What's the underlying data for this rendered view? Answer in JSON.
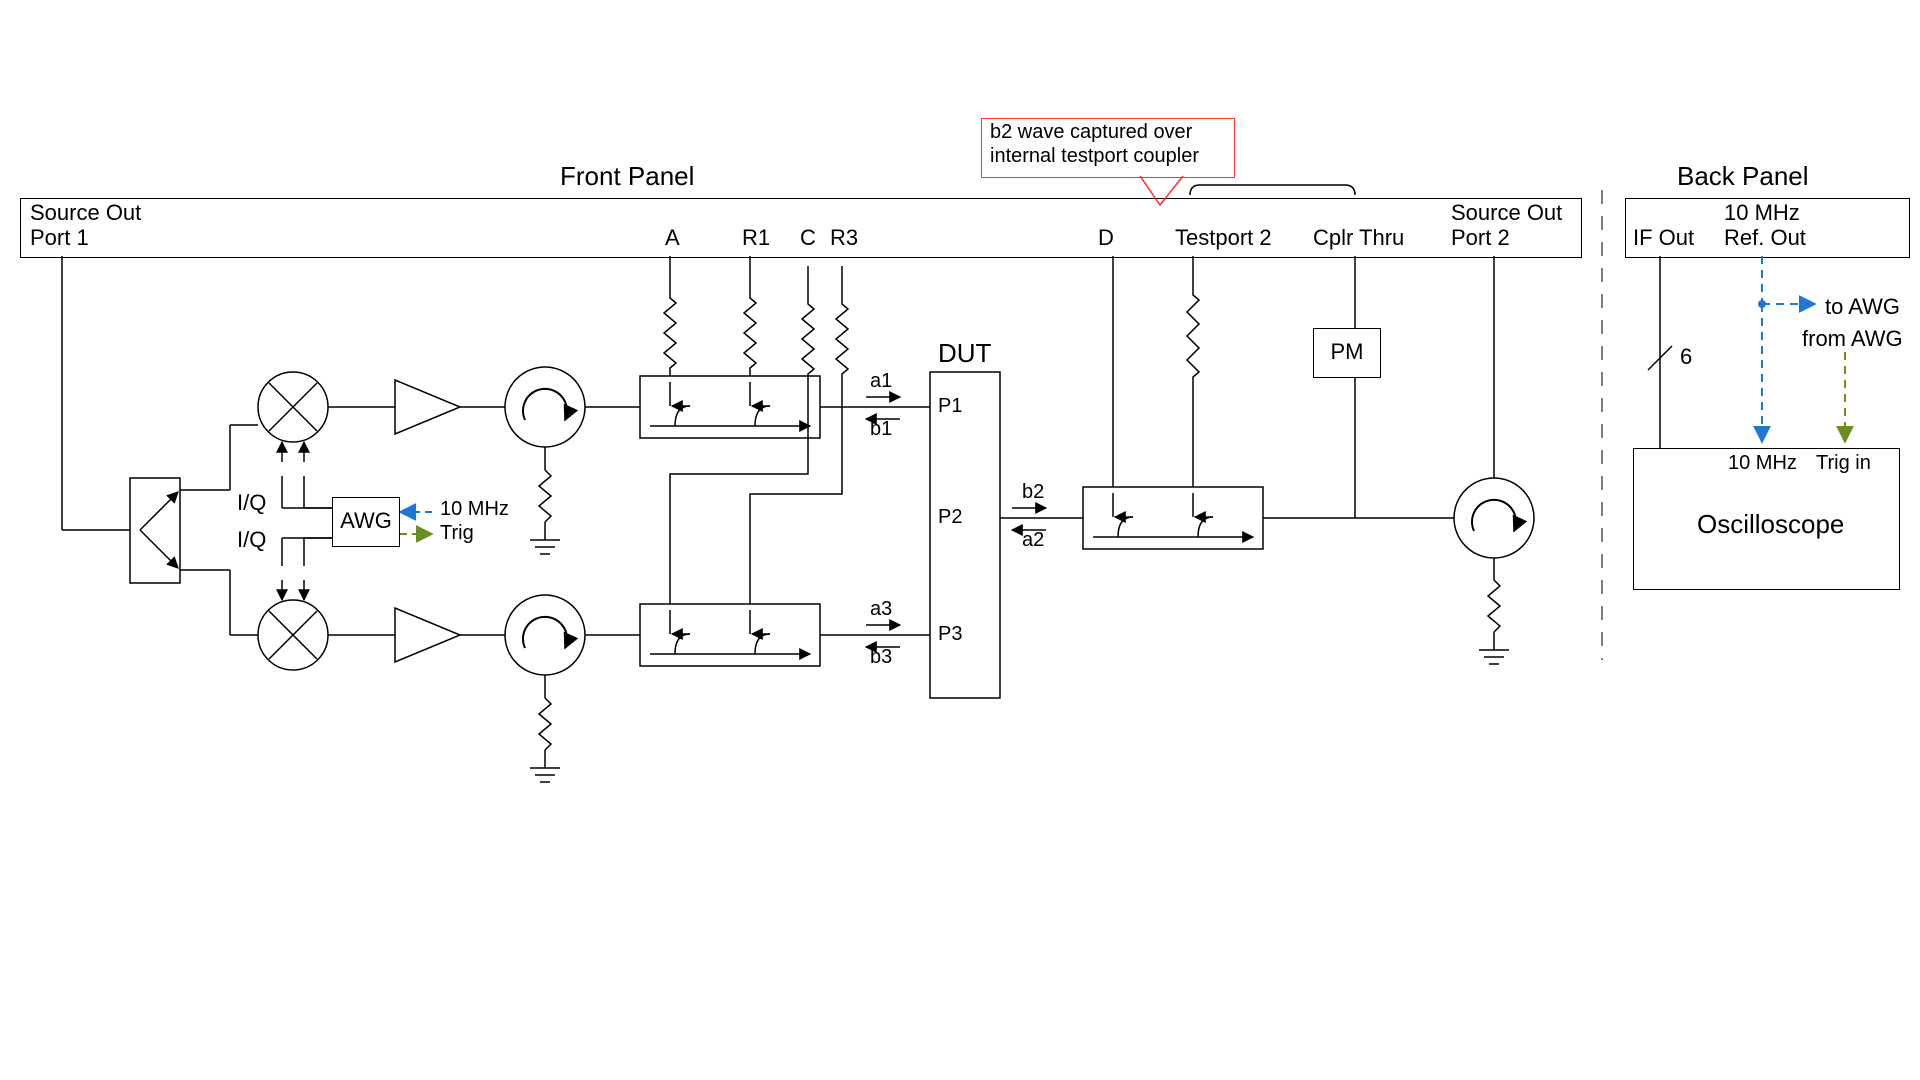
{
  "titles": {
    "front_panel": "Front Panel",
    "back_panel": "Back Panel"
  },
  "front_ports": {
    "source_out_port1_line1": "Source Out",
    "source_out_port1_line2": "Port 1",
    "A": "A",
    "R1": "R1",
    "C": "C",
    "R3": "R3",
    "D": "D",
    "testport2": "Testport 2",
    "cplr_thru": "Cplr Thru",
    "source_out_port2_line1": "Source Out",
    "source_out_port2_line2": "Port 2"
  },
  "back_ports": {
    "if_out": "IF Out",
    "ten_mhz_line1": "10 MHz",
    "ten_mhz_line2": "Ref. Out",
    "to_awg": "to AWG",
    "from_awg": "from AWG",
    "osc_10mhz": "10 MHz",
    "osc_trig_in": "Trig in",
    "bus_slash": "6"
  },
  "blocks": {
    "awg": "AWG",
    "pm": "PM",
    "dut": "DUT",
    "oscilloscope": "Oscilloscope"
  },
  "awg_side": {
    "iq_top": "I/Q",
    "iq_bot": "I/Q",
    "ten_mhz": "10 MHz",
    "trig": "Trig"
  },
  "dut_ports": {
    "a1": "a1",
    "b1": "b1",
    "P1": "P1",
    "b2": "b2",
    "a2": "a2",
    "P2": "P2",
    "a3": "a3",
    "b3": "b3",
    "P3": "P3"
  },
  "callout": {
    "line1": "b2 wave captured over",
    "line2": "internal testport coupler"
  }
}
